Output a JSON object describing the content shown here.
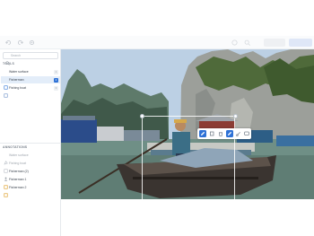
{
  "sidebar": {
    "search": {
      "placeholder": "Search"
    },
    "tools_title": "TOOLS",
    "tools": [
      {
        "label": "Water surface",
        "key": "1"
      },
      {
        "label": "Fisherman",
        "key": "2"
      },
      {
        "label": "Fishing boat",
        "key": "3"
      }
    ],
    "annotations_title": "ANNOTATIONS",
    "annotations": [
      {
        "label": "Water surface"
      },
      {
        "label": "Fishing boat"
      },
      {
        "label": "Fisherman (2)"
      },
      {
        "label": "Fisherman 1"
      },
      {
        "label": "Fisherman 2"
      }
    ]
  },
  "colors": {
    "accent": "#2f72d6",
    "active_row": "#e3edf9"
  },
  "icons": {
    "toolbar": [
      "undo-icon",
      "redo-icon",
      "settings-icon",
      "help-icon",
      "zoom-icon"
    ],
    "float_bar": [
      "edit-icon",
      "copy-icon",
      "delete-icon",
      "check-icon",
      "link-icon",
      "comment-icon"
    ]
  }
}
